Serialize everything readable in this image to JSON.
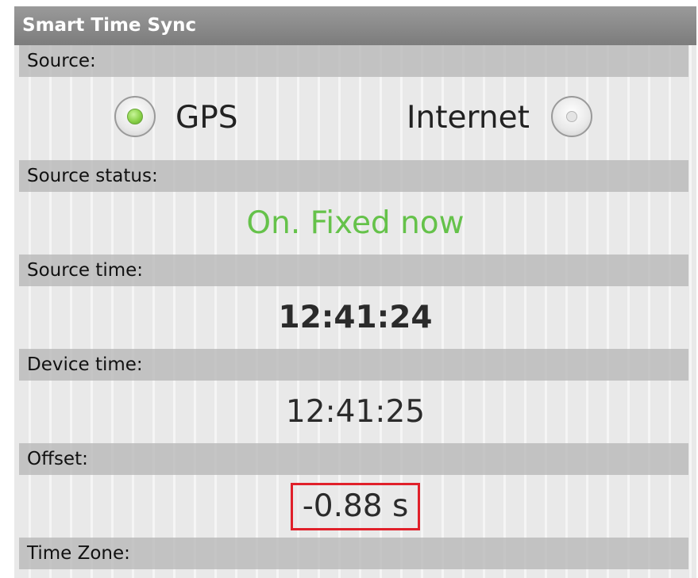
{
  "app": {
    "title": "Smart Time Sync"
  },
  "source": {
    "header": "Source:",
    "options": [
      {
        "label": "GPS",
        "selected": true
      },
      {
        "label": "Internet",
        "selected": false
      }
    ]
  },
  "source_status": {
    "header": "Source status:",
    "value": "On. Fixed now",
    "color": "#65c24a"
  },
  "source_time": {
    "header": "Source time:",
    "value": "12:41:24"
  },
  "device_time": {
    "header": "Device time:",
    "value": "12:41:25"
  },
  "offset": {
    "header": "Offset:",
    "value": "-0.88 s",
    "highlight_color": "#e0202a"
  },
  "time_zone": {
    "header": "Time Zone:"
  }
}
